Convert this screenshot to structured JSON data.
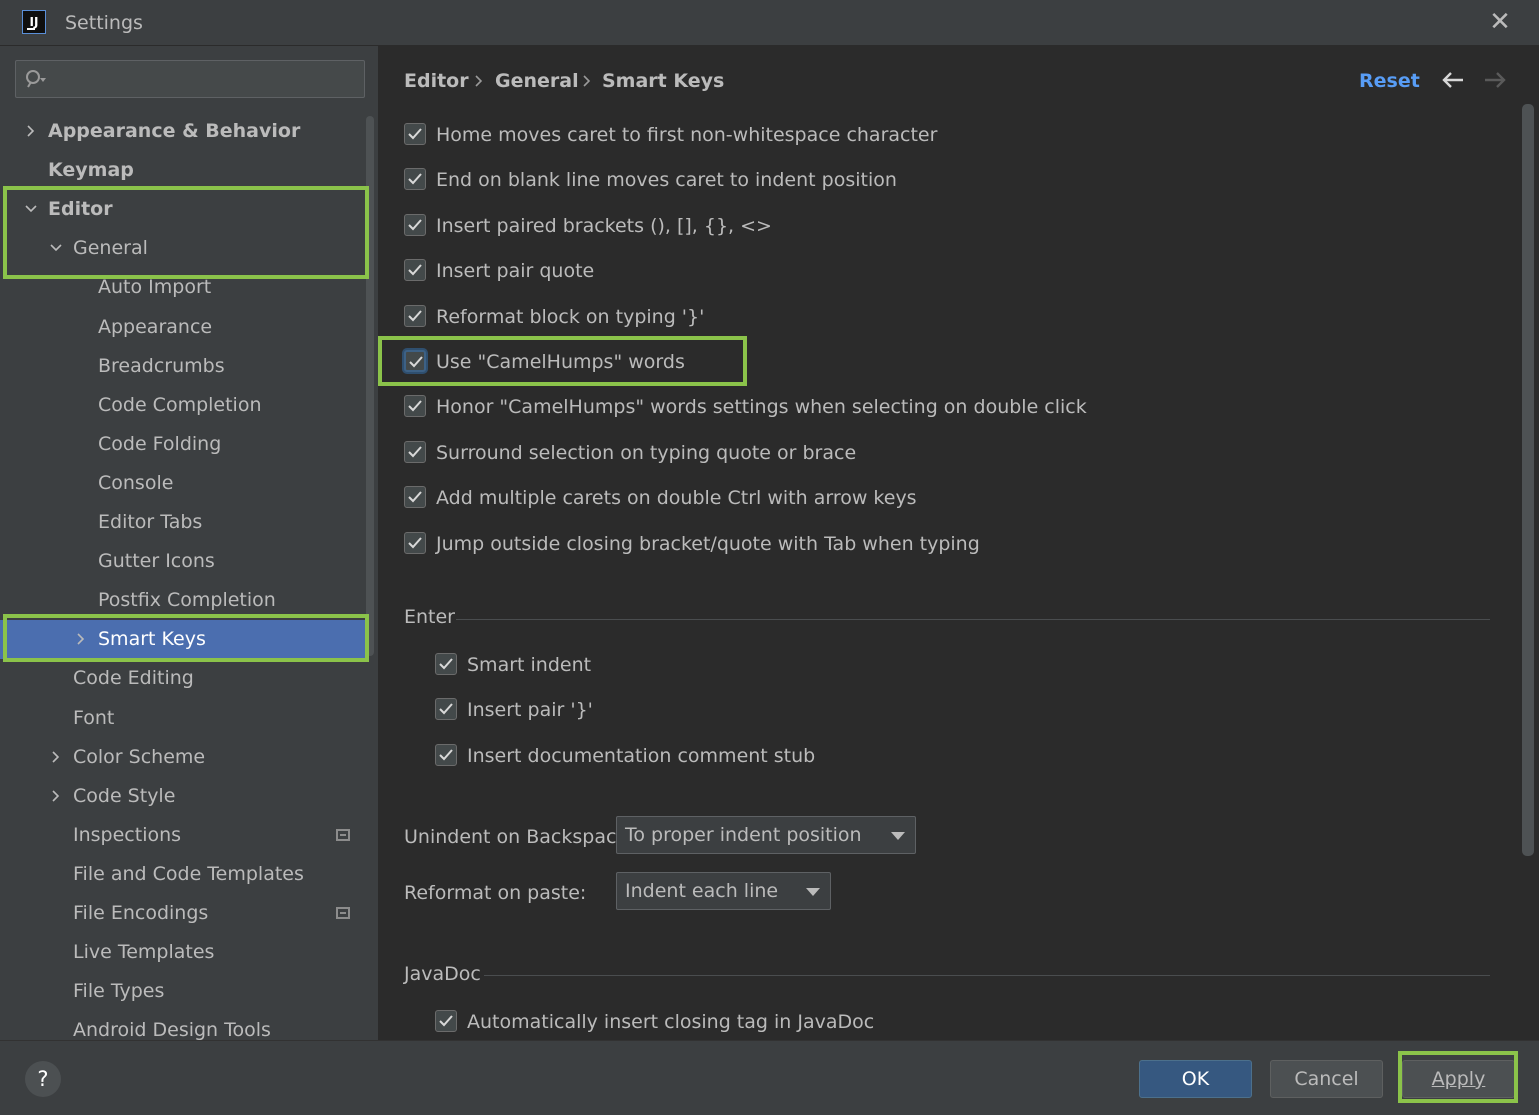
{
  "window": {
    "title": "Settings",
    "app_icon": "IJ"
  },
  "search": {
    "placeholder": ""
  },
  "tree": {
    "items": [
      {
        "label": "Appearance & Behavior",
        "level": 0,
        "expandable": true,
        "expanded": false,
        "bold": true
      },
      {
        "label": "Keymap",
        "level": 0,
        "expandable": false,
        "bold": true
      },
      {
        "label": "Editor",
        "level": 0,
        "expandable": true,
        "expanded": true,
        "bold": true
      },
      {
        "label": "General",
        "level": 1,
        "expandable": true,
        "expanded": true
      },
      {
        "label": "Auto Import",
        "level": 2
      },
      {
        "label": "Appearance",
        "level": 2
      },
      {
        "label": "Breadcrumbs",
        "level": 2
      },
      {
        "label": "Code Completion",
        "level": 2
      },
      {
        "label": "Code Folding",
        "level": 2
      },
      {
        "label": "Console",
        "level": 2
      },
      {
        "label": "Editor Tabs",
        "level": 2
      },
      {
        "label": "Gutter Icons",
        "level": 2
      },
      {
        "label": "Postfix Completion",
        "level": 2
      },
      {
        "label": "Smart Keys",
        "level": 2,
        "expandable": true,
        "expanded": false,
        "selected": true
      },
      {
        "label": "Code Editing",
        "level": 1
      },
      {
        "label": "Font",
        "level": 1
      },
      {
        "label": "Color Scheme",
        "level": 1,
        "expandable": true,
        "expanded": false
      },
      {
        "label": "Code Style",
        "level": 1,
        "expandable": true,
        "expanded": false
      },
      {
        "label": "Inspections",
        "level": 1,
        "project_icon": true
      },
      {
        "label": "File and Code Templates",
        "level": 1
      },
      {
        "label": "File Encodings",
        "level": 1,
        "project_icon": true
      },
      {
        "label": "Live Templates",
        "level": 1
      },
      {
        "label": "File Types",
        "level": 1
      },
      {
        "label": "Android Design Tools",
        "level": 1
      }
    ]
  },
  "breadcrumb": [
    "Editor",
    "General",
    "Smart Keys"
  ],
  "header": {
    "reset_label": "Reset"
  },
  "options": [
    {
      "label": "Home moves caret to first non-whitespace character",
      "checked": true
    },
    {
      "label": "End on blank line moves caret to indent position",
      "checked": true
    },
    {
      "label": "Insert paired brackets (), [], {}, <>",
      "checked": true
    },
    {
      "label": "Insert pair quote",
      "checked": true
    },
    {
      "label": "Reformat block on typing '}'",
      "checked": true
    },
    {
      "label": "Use \"CamelHumps\" words",
      "checked": true,
      "focused": true
    },
    {
      "label": "Honor \"CamelHumps\" words settings when selecting on double click",
      "checked": true
    },
    {
      "label": "Surround selection on typing quote or brace",
      "checked": true
    },
    {
      "label": "Add multiple carets on double Ctrl with arrow keys",
      "checked": true
    },
    {
      "label": "Jump outside closing bracket/quote with Tab when typing",
      "checked": true
    }
  ],
  "enter_section": {
    "title": "Enter",
    "options": [
      {
        "label": "Smart indent",
        "checked": true
      },
      {
        "label": "Insert pair '}'",
        "checked": true
      },
      {
        "label": "Insert documentation comment stub",
        "checked": true
      }
    ]
  },
  "unindent": {
    "label": "Unindent on Backspace:",
    "value": "To proper indent position"
  },
  "reformat_paste": {
    "label": "Reformat on paste:",
    "value": "Indent each line"
  },
  "javadoc_section": {
    "title": "JavaDoc",
    "options": [
      {
        "label": "Automatically insert closing tag in JavaDoc",
        "checked": true
      }
    ]
  },
  "footer": {
    "help_label": "?",
    "ok_label": "OK",
    "cancel_label": "Cancel",
    "apply_label": "Apply"
  },
  "colors": {
    "selection": "#4b6eaf",
    "link": "#589df6",
    "highlight": "#8bc34a",
    "primary_button": "#365880"
  }
}
